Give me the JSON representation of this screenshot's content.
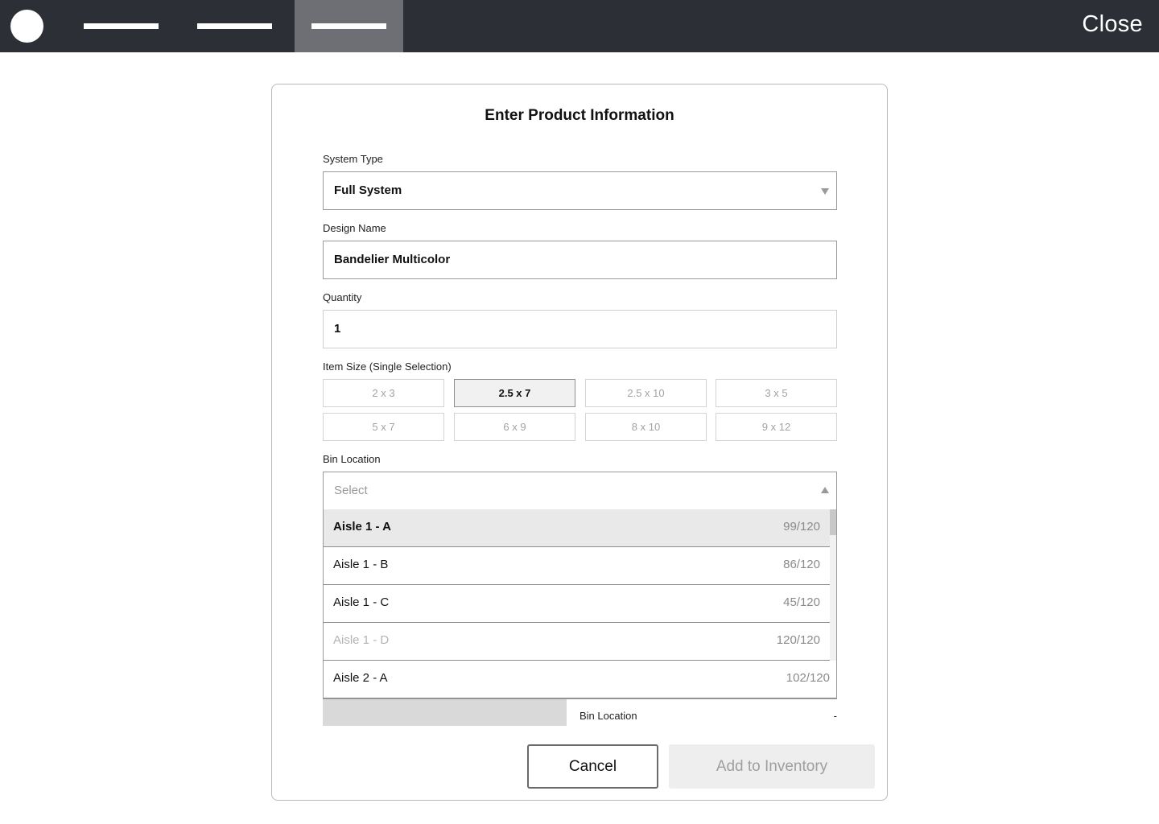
{
  "topbar": {
    "nav_items": [
      "",
      "",
      ""
    ],
    "active_index": 2,
    "close_label": "Close"
  },
  "modal": {
    "title": "Enter Product Information",
    "system_type": {
      "label": "System Type",
      "value": "Full System"
    },
    "design_name": {
      "label": "Design Name",
      "value": "Bandelier Multicolor"
    },
    "quantity": {
      "label": "Quantity",
      "value": "1"
    },
    "item_size": {
      "label": "Item Size (Single Selection)",
      "options": [
        "2 x 3",
        "2.5 x 7",
        "2.5 x 10",
        "3 x 5",
        "5 x 7",
        "6 x 9",
        "8 x 10",
        "9 x 12"
      ],
      "selected": "2.5 x 7"
    },
    "bin_location": {
      "label": "Bin Location",
      "placeholder": "Select",
      "options": [
        {
          "name": "Aisle 1 - A",
          "capacity": "99/120",
          "state": "highlighted"
        },
        {
          "name": "Aisle 1 - B",
          "capacity": "86/120",
          "state": "normal"
        },
        {
          "name": "Aisle 1 - C",
          "capacity": "45/120",
          "state": "normal"
        },
        {
          "name": "Aisle 1 - D",
          "capacity": "120/120",
          "state": "disabled"
        },
        {
          "name": "Aisle 2 - A",
          "capacity": "102/120",
          "state": "normal"
        }
      ]
    },
    "summary": {
      "bin_location_label": "Bin Location",
      "bin_location_value": "-"
    },
    "cancel_label": "Cancel",
    "add_label": "Add to Inventory"
  },
  "colors": {
    "topbar_bg": "#2c2f36",
    "active_tab_bg": "#6d6f74",
    "highlight_row": "#e9e9e9",
    "disabled_button_bg": "#eeeeee"
  }
}
